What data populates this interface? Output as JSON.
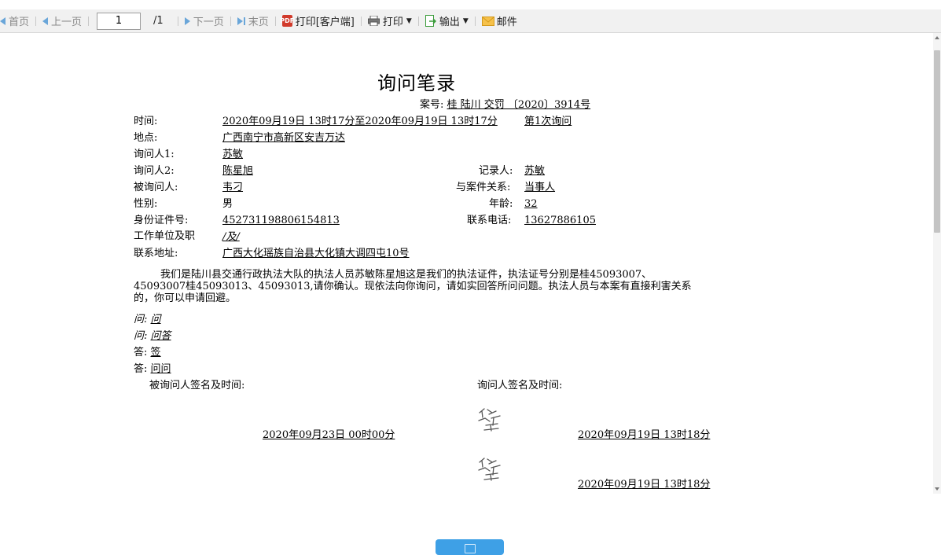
{
  "toolbar": {
    "first_label": "首页",
    "prev_label": "上一页",
    "page_value": "1",
    "page_total": "/1",
    "next_label": "下一页",
    "last_label": "末页",
    "print_client_label": "打印[客户端]",
    "print_label": "打印",
    "export_label": "输出",
    "mail_label": "邮件"
  },
  "document": {
    "title": "询问笔录",
    "case_label": "案号:",
    "case_number": "桂 陆川 交罚 〔2020〕3914号",
    "time_label": "时间:",
    "time_value": "2020年09月19日 13时17分至2020年09月19日 13时17分",
    "session_value": "第1次询问",
    "place_label": "地点:",
    "place_value": "广西南宁市高新区安吉万达",
    "inquirer1_label": "询问人1:",
    "inquirer1_value": "苏敏",
    "inquirer2_label": "询问人2:",
    "inquirer2_value": "陈星旭",
    "recorder_label": "记录人:",
    "recorder_value": "苏敏",
    "inquiree_label": "被询问人:",
    "inquiree_value": "韦刁",
    "relation_label": "与案件关系:",
    "relation_value": "当事人",
    "gender_label": "性别:",
    "gender_value": "男",
    "age_label": "年龄:",
    "age_value": "32",
    "id_label": "身份证件号:",
    "id_value": "452731198806154813",
    "phone_label": "联系电话:",
    "phone_value": "13627886105",
    "work_label": "工作单位及职",
    "work_value": "/及/",
    "address_label": "联系地址:",
    "address_value": "广西大化瑶族自治县大化镇大调四屯10号",
    "statement": "我们是陆川县交通行政执法大队的执法人员苏敏陈星旭这是我们的执法证件，执法证号分别是桂45093007、45093007桂45093013、45093013,请你确认。现依法向你询问，请如实回答所问问题。执法人员与本案有直接利害关系的，你可以申请回避。",
    "q1_label": "问:",
    "q1_value": "问",
    "q2_label": "问:",
    "q2_value": "问答",
    "a1_label": "答:",
    "a1_value": "签",
    "a2_label": "答:",
    "a2_value": "问问",
    "inquiree_sign_label": "被询问人签名及时间:",
    "inquirer_sign_label": "询问人签名及时间:",
    "inquiree_sign_date": "2020年09月23日 00时00分",
    "inquirer_sign_date1": "2020年09月19日 13时18分",
    "inquirer_sign_date2": "2020年09月19日 13时18分"
  },
  "colors": {
    "toolbar_bg": "#f1f1f1",
    "nav_arrow": "#6aa6d9",
    "pdf_red": "#d13a2b",
    "button_blue": "#3ea0e6"
  }
}
